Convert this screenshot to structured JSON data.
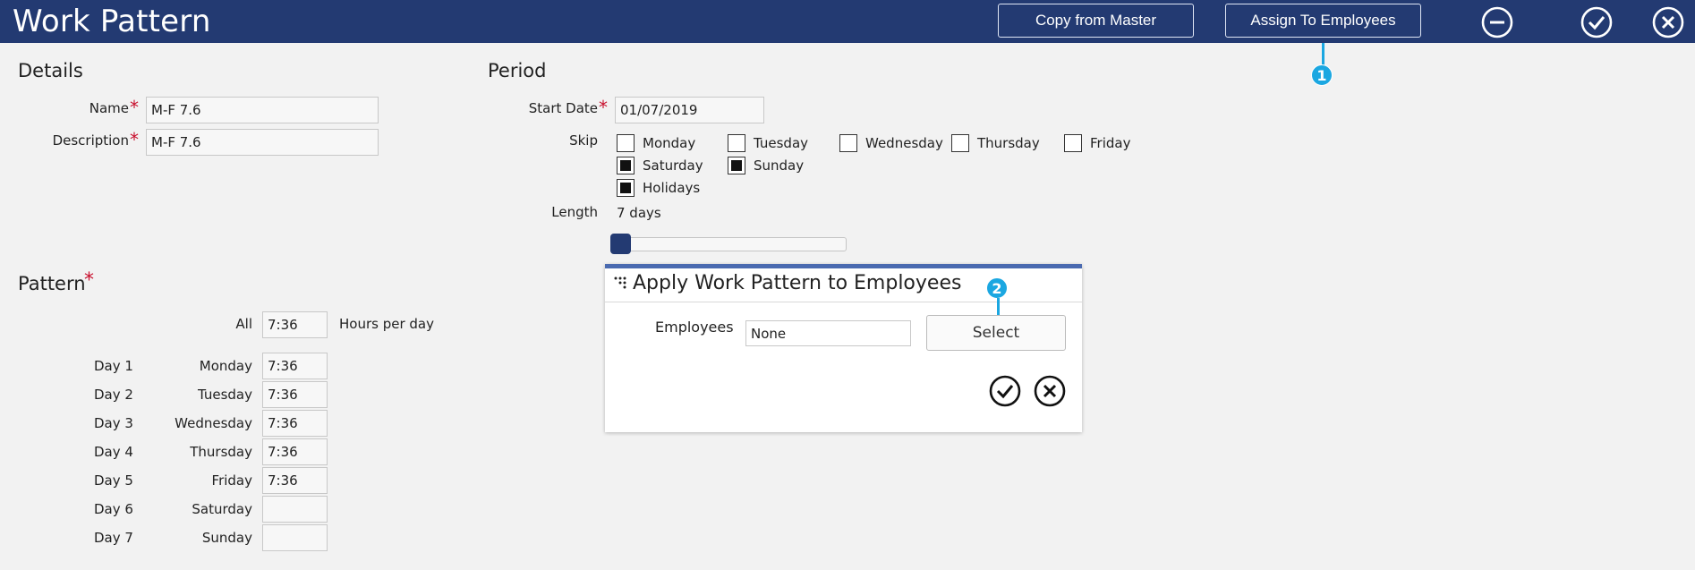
{
  "header": {
    "title": "Work Pattern",
    "copy_label": "Copy from Master",
    "assign_label": "Assign To Employees",
    "icons": [
      "minus-circle-icon",
      "check-circle-icon",
      "close-circle-icon"
    ]
  },
  "callouts": {
    "one": "1",
    "two": "2"
  },
  "details": {
    "title": "Details",
    "name_label": "Name",
    "name_value": "M-F 7.6",
    "description_label": "Description",
    "description_value": "M-F 7.6",
    "required_mark": "*"
  },
  "period": {
    "title": "Period",
    "start_label": "Start Date",
    "start_value": "01/07/2019",
    "skip_label": "Skip",
    "skip_days": [
      {
        "label": "Monday",
        "checked": false
      },
      {
        "label": "Tuesday",
        "checked": false
      },
      {
        "label": "Wednesday",
        "checked": false
      },
      {
        "label": "Thursday",
        "checked": false
      },
      {
        "label": "Friday",
        "checked": false
      },
      {
        "label": "Saturday",
        "checked": true
      },
      {
        "label": "Sunday",
        "checked": true
      },
      {
        "label": "Holidays",
        "checked": true
      }
    ],
    "length_label": "Length",
    "length_value": "7 days",
    "length_slider_fraction": 0.0
  },
  "pattern": {
    "title": "Pattern",
    "all_label": "All",
    "all_value": "7:36",
    "hours_per_day": "Hours per day",
    "days": [
      {
        "day": "Day 1",
        "name": "Monday",
        "value": "7:36"
      },
      {
        "day": "Day 2",
        "name": "Tuesday",
        "value": "7:36"
      },
      {
        "day": "Day 3",
        "name": "Wednesday",
        "value": "7:36"
      },
      {
        "day": "Day 4",
        "name": "Thursday",
        "value": "7:36"
      },
      {
        "day": "Day 5",
        "name": "Friday",
        "value": "7:36"
      },
      {
        "day": "Day 6",
        "name": "Saturday",
        "value": ""
      },
      {
        "day": "Day 7",
        "name": "Sunday",
        "value": ""
      }
    ]
  },
  "dialog": {
    "title": "Apply Work Pattern to Employees",
    "employees_label": "Employees",
    "employees_value": "None",
    "select_label": "Select"
  },
  "colors": {
    "header_bg": "#233a72",
    "callout": "#1ba7e1",
    "required": "#c8102e"
  }
}
